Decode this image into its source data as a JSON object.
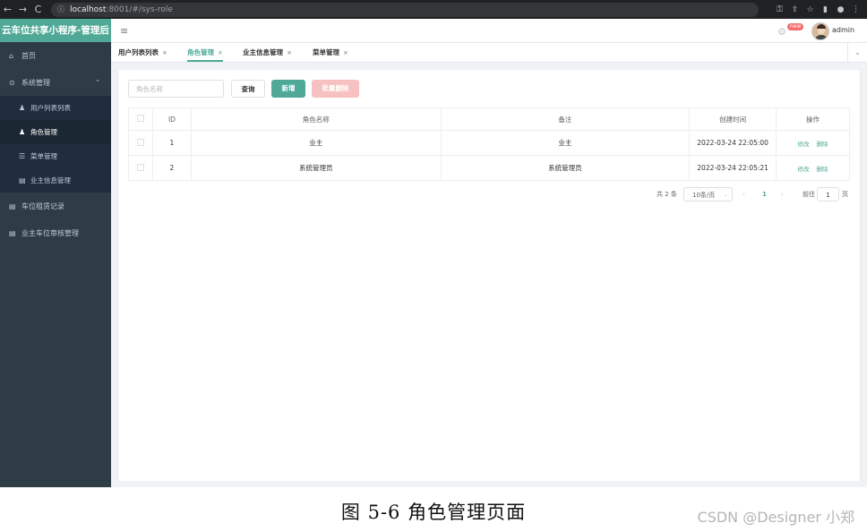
{
  "browser": {
    "url_host": "localhost",
    "url_rest": ":8001/#/sys-role",
    "back_icon": "←",
    "forward_icon": "→",
    "reload_icon": "C"
  },
  "sidebar": {
    "logo": "云车位共享小程序-管理后",
    "items": [
      {
        "label": "首页",
        "icon": "home-icon"
      },
      {
        "label": "系统管理",
        "icon": "settings-icon"
      },
      {
        "label": "车位租赁记录",
        "icon": "document-icon"
      },
      {
        "label": "业主车位审核管理",
        "icon": "document-icon"
      }
    ],
    "submenu": [
      {
        "label": "用户列表列表",
        "icon": "user-icon"
      },
      {
        "label": "角色管理",
        "icon": "user-icon"
      },
      {
        "label": "菜单管理",
        "icon": "list-icon"
      },
      {
        "label": "业主信息管理",
        "icon": "document-icon"
      }
    ]
  },
  "header": {
    "hamburger": "≡",
    "badge": "new",
    "username": "admin"
  },
  "tabs": [
    {
      "label": "用户列表列表",
      "close": "×"
    },
    {
      "label": "角色管理",
      "close": "×"
    },
    {
      "label": "业主信息管理",
      "close": "×"
    },
    {
      "label": "菜单管理",
      "close": "×"
    }
  ],
  "toolbar": {
    "search_placeholder": "角色名称",
    "query_label": "查询",
    "add_label": "新增",
    "batch_delete_label": "批量删除"
  },
  "table": {
    "columns": [
      "ID",
      "角色名称",
      "备注",
      "创建时间",
      "操作"
    ],
    "rows": [
      {
        "id": "1",
        "name": "业主",
        "remark": "业主",
        "created": "2022-03-24 22:05:00",
        "edit": "修改",
        "del": "删除"
      },
      {
        "id": "2",
        "name": "系统管理员",
        "remark": "系统管理员",
        "created": "2022-03-24 22:05:21",
        "edit": "修改",
        "del": "删除"
      }
    ]
  },
  "pagination": {
    "total": "共 2 条",
    "page_size": "10条/页",
    "current_page": "1",
    "goto_label": "前往",
    "goto_value": "1",
    "page_unit": "页"
  },
  "caption": "图 5-6   角色管理页面",
  "watermark": "CSDN @Designer 小郑",
  "colors": {
    "accent": "#4fa996",
    "sidebar_bg": "#2e3c46",
    "danger_light": "#f8c1c1"
  }
}
